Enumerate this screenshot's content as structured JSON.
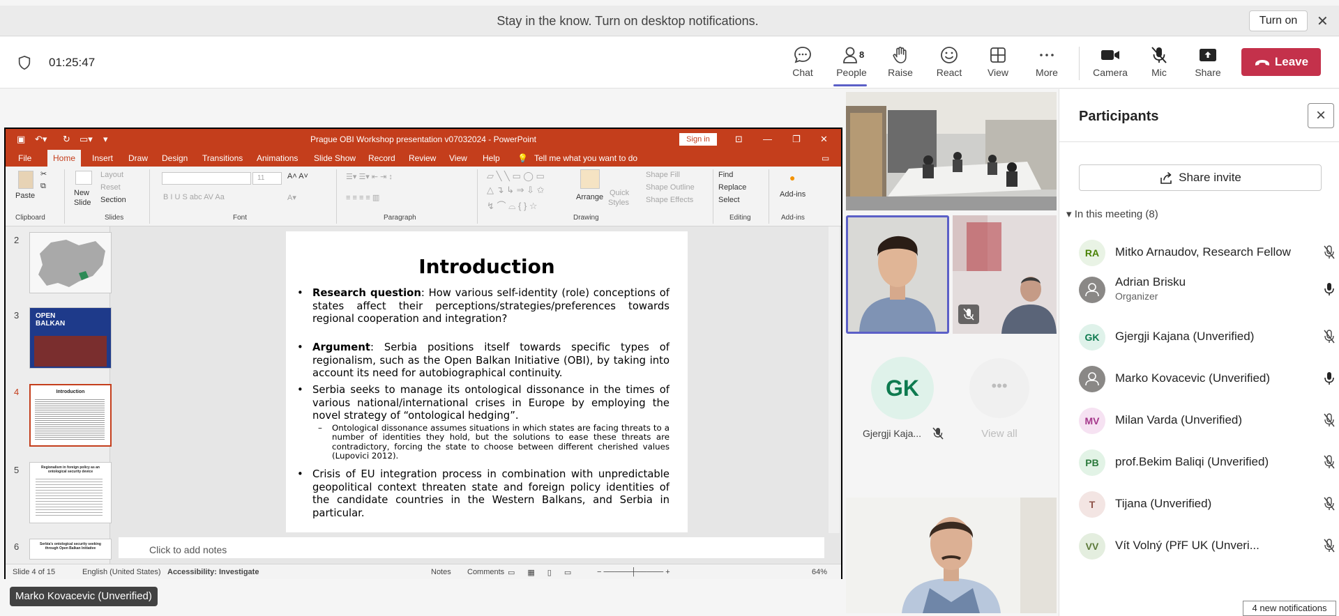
{
  "banner": {
    "text": "Stay in the know. Turn on desktop notifications.",
    "turn_on_label": "Turn on"
  },
  "meeting": {
    "timer": "01:25:47"
  },
  "toolbar": {
    "chat": "Chat",
    "people": "People",
    "people_count": "8",
    "raise": "Raise",
    "react": "React",
    "view": "View",
    "more": "More",
    "camera": "Camera",
    "mic": "Mic",
    "share": "Share",
    "leave": "Leave"
  },
  "ppt": {
    "title": "Prague OBI Workshop presentation v07032024 - PowerPoint",
    "sign_in": "Sign in",
    "tabs": [
      "File",
      "Home",
      "Insert",
      "Draw",
      "Design",
      "Transitions",
      "Animations",
      "Slide Show",
      "Record",
      "Review",
      "View",
      "Help"
    ],
    "tell_me": "Tell me what you want to do",
    "ribbon": {
      "clipboard": "Clipboard",
      "paste": "Paste",
      "slides": "Slides",
      "new": "New",
      "slide": "Slide",
      "layout": "Layout",
      "reset": "Reset",
      "section": "Section",
      "font": "Font",
      "font_size": "11",
      "paragraph": "Paragraph",
      "drawing": "Drawing",
      "arrange": "Arrange",
      "quick": "Quick",
      "styles": "Styles",
      "shape_fill": "Shape Fill",
      "shape_outline": "Shape Outline",
      "shape_effects": "Shape Effects",
      "editing": "Editing",
      "find": "Find",
      "replace": "Replace",
      "select": "Select",
      "addins_group": "Add-ins",
      "addins": "Add-ins"
    },
    "thumbs": [
      {
        "num": "2"
      },
      {
        "num": "3",
        "title": "OPEN BALKAN"
      },
      {
        "num": "4",
        "title": "Introduction"
      },
      {
        "num": "5",
        "title": "Regionalism in foreign policy as an ontological security device"
      },
      {
        "num": "6",
        "title": "Serbia's ontological security seeking through Open Balkan Initiative"
      }
    ],
    "slide": {
      "title": "Introduction",
      "b1_label": "Research question",
      "b1_text": ": How various self-identity (role) conceptions of states affect their perceptions/strategies/preferences towards regional cooperation and integration?",
      "b2_label": "Argument",
      "b2_text": ": Serbia positions itself towards specific types of regionalism, such as the Open Balkan Initiative (OBI), by taking into account its need for autobiographical continuity.",
      "b3_text": "Serbia seeks to manage its ontological dissonance in the times of various national/international crises in Europe by employing the novel strategy of “ontological hedging”.",
      "b3_sub": "Ontological dissonance assumes situations in which states are facing threats to a number of identities they hold, but the solutions to ease these threats are contradictory, forcing the state to choose between different cherished values (Lupovici 2012).",
      "b4_text": "Crisis of EU integration process in combination with unpredictable geopolitical context threaten state and foreign policy identities of the candidate countries in the Western Balkans, and Serbia in particular."
    },
    "notes_placeholder": "Click to add notes",
    "status": {
      "slide": "Slide 4 of 15",
      "language": "English (United States)",
      "accessibility": "Accessibility: Investigate",
      "notes": "Notes",
      "comments": "Comments",
      "zoom": "64%"
    }
  },
  "presenter_caption": "Marko Kovacevic (Unverified)",
  "tiles": {
    "gk_initials": "GK",
    "gk_name": "Gjergji Kaja...",
    "view_all": "View all"
  },
  "participants_panel": {
    "title": "Participants",
    "share_invite": "Share invite",
    "in_meeting": "In this meeting (8)",
    "people": [
      {
        "initials": "RA",
        "name": "Mitko Arnaudov, Research Fellow",
        "mic": "muted",
        "bg": "#e9f3e5",
        "fg": "#498205"
      },
      {
        "initials": "",
        "name": "Adrian Brisku",
        "subtitle": "Organizer",
        "mic": "on",
        "bg": "#8a8886",
        "fg": "#ffffff"
      },
      {
        "initials": "GK",
        "name": "Gjergji Kajana (Unverified)",
        "mic": "muted",
        "bg": "#dff2ea",
        "fg": "#0e7a4f"
      },
      {
        "initials": "",
        "name": "Marko Kovacevic (Unverified)",
        "mic": "on",
        "bg": "#8a8886",
        "fg": "#ffffff"
      },
      {
        "initials": "MV",
        "name": "Milan Varda (Unverified)",
        "mic": "muted",
        "bg": "#f6e2f2",
        "fg": "#a4378a"
      },
      {
        "initials": "PB",
        "name": "prof.Bekim Baliqi (Unverified)",
        "mic": "muted",
        "bg": "#e2f3e6",
        "fg": "#2b7a3c"
      },
      {
        "initials": "T",
        "name": "Tijana (Unverified)",
        "mic": "muted",
        "bg": "#f3e5e3",
        "fg": "#8e5248"
      },
      {
        "initials": "VV",
        "name": "Vít Volný (PřF UK (Unveri...",
        "mic": "muted",
        "bg": "#e4eedf",
        "fg": "#5c7a3a"
      }
    ]
  },
  "notifications": "4 new notifications",
  "colors": {
    "teams_accent": "#5b5fc7",
    "leave_red": "#c4314b",
    "ppt_orange": "#c43e1c"
  }
}
